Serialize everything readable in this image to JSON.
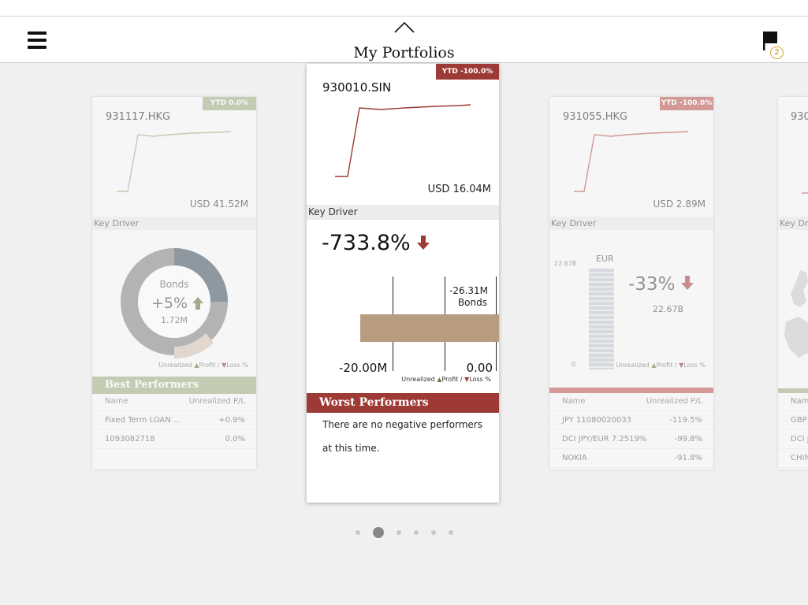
{
  "header": {
    "title": "My Portfolios",
    "alerts_count": "2"
  },
  "colors": {
    "green": "#a8b48c",
    "red": "#9e3a36",
    "pink": "#d9a8a6",
    "tan": "#b89c80",
    "gray_ring": "#8b8b8b"
  },
  "cards": [
    {
      "ticker": "931117.HKG",
      "ytd": "YTD 0.0%",
      "usd": "USD 41.52M",
      "key_driver_label": "Key Driver",
      "donut": {
        "category": "Bonds",
        "pct": "+5%",
        "amount": "1.72M"
      },
      "legend": {
        "unrealized": "Unrealized",
        "profit": "Profit",
        "slash": "/",
        "loss": "Loss %"
      },
      "performers": {
        "title": "Best Performers",
        "col_name": "Name",
        "col_value": "Unrealized P/L",
        "rows": [
          {
            "name": "Fixed Term LOAN …",
            "value": "+0.9%"
          },
          {
            "name": "1093082718",
            "value": "0.0%"
          }
        ]
      }
    },
    {
      "ticker": "930010.SIN",
      "ytd": "YTD -100.0%",
      "usd": "USD 16.04M",
      "key_driver_label": "Key Driver",
      "big_pct": "-733.8%",
      "bar": {
        "value": "-26.31M",
        "category": "Bonds",
        "axis_left": "-20.00M",
        "axis_right": "0.00"
      },
      "legend": {
        "unrealized": "Unrealized",
        "profit": "Profit",
        "slash": "/",
        "loss": "Loss %"
      },
      "performers": {
        "title": "Worst Performers",
        "empty_line1": "There are no negative performers",
        "empty_line2": "at this time."
      }
    },
    {
      "ticker": "931055.HKG",
      "ytd": "YTD -100.0%",
      "usd": "USD 2.89M",
      "key_driver_label": "Key Driver",
      "currency": {
        "code": "EUR",
        "top_label": "22.67B",
        "zero": "0",
        "pct": "-33%",
        "amount": "22.67B"
      },
      "legend": {
        "unrealized": "Unrealized",
        "profit": "Profit",
        "slash": "/",
        "loss": "Loss %"
      },
      "performers": {
        "col_name": "Name",
        "col_value": "Unrealized P/L",
        "rows": [
          {
            "name": "JPY 11080020033",
            "value": "-119.5%"
          },
          {
            "name": "DCI JPY/EUR 7.2519%",
            "value": "-99.8%"
          },
          {
            "name": "NOKIA",
            "value": "-91.8%"
          }
        ]
      }
    },
    {
      "ticker": "930",
      "key_driver_label": "Key Drive",
      "rows": [
        "Nam",
        "GBP",
        "DCI J",
        "CHIN"
      ]
    }
  ],
  "pagination": {
    "total": 6,
    "active": 1
  }
}
